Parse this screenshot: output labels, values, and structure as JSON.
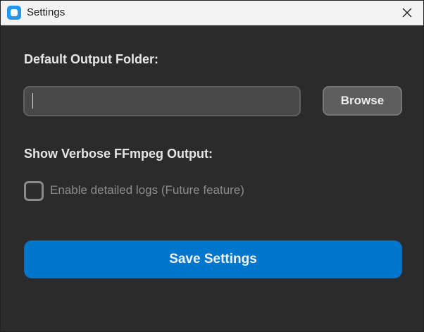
{
  "window": {
    "title": "Settings",
    "icon": "app-icon",
    "close_icon": "close-icon"
  },
  "output_folder": {
    "label": "Default Output Folder:",
    "value": "",
    "placeholder": "",
    "browse_label": "Browse"
  },
  "verbose": {
    "label": "Show Verbose FFmpeg Output:",
    "checkbox_label": "Enable detailed logs (Future feature)",
    "checked": false,
    "disabled": true
  },
  "save_label": "Save Settings",
  "colors": {
    "background": "#2b2b2b",
    "titlebar": "#f3f3f3",
    "accent": "#0077cc",
    "input_bg": "#484848",
    "button_bg": "#5e5e5e"
  }
}
